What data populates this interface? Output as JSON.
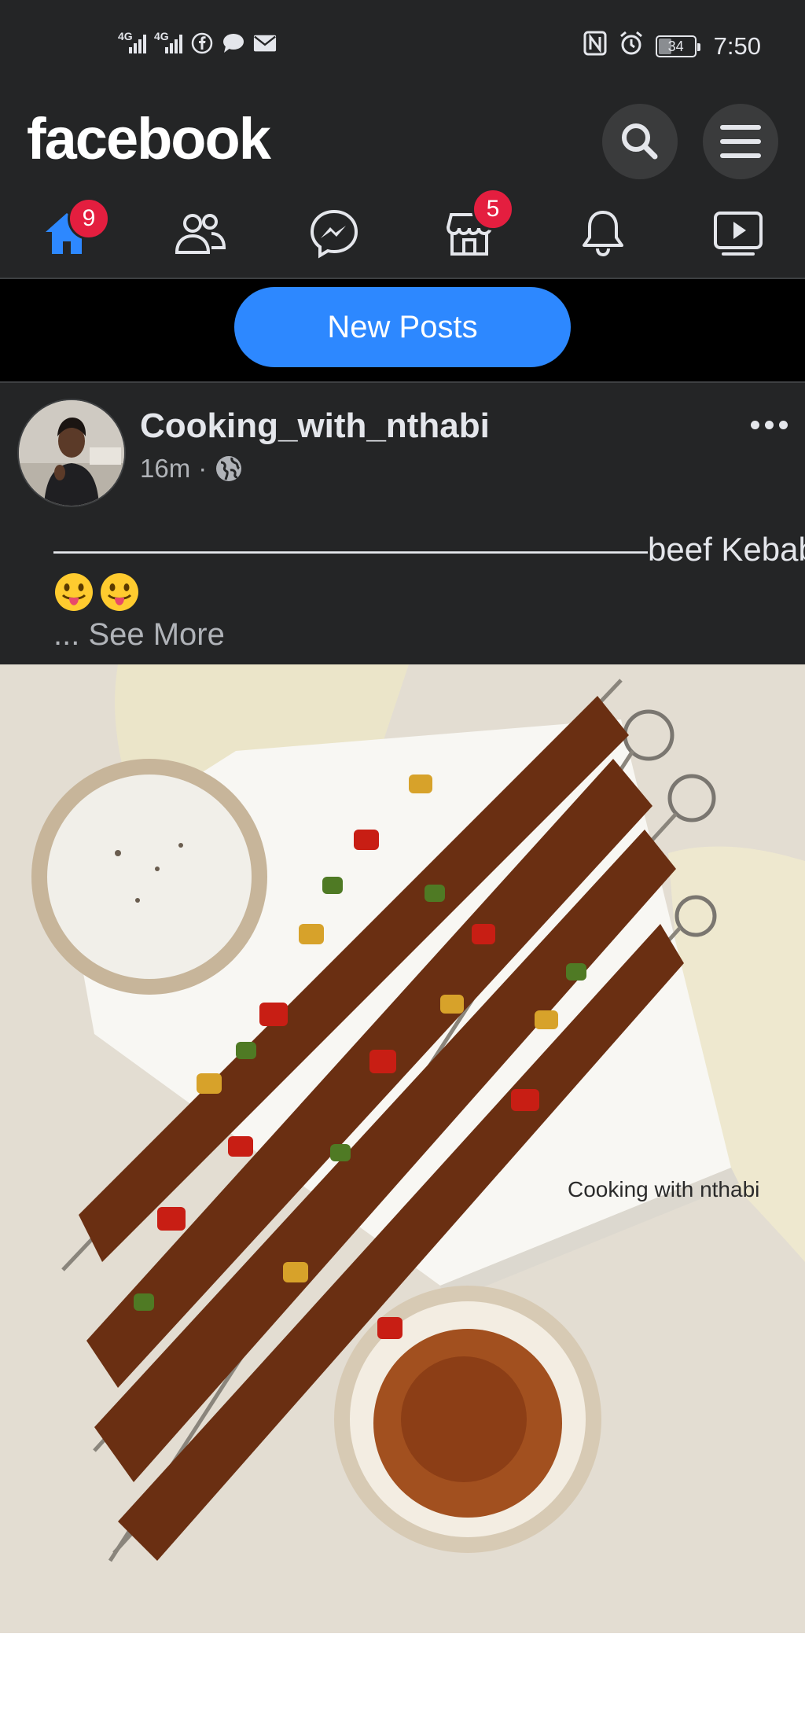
{
  "status_bar": {
    "net1": "4G",
    "net2": "4G",
    "battery": "34",
    "time": "7:50",
    "icons": [
      "signal-icon",
      "facebook-icon",
      "chat-bubble-icon",
      "mail-icon",
      "nfc-icon",
      "alarm-icon",
      "battery-icon"
    ]
  },
  "header": {
    "logo": "facebook",
    "actions": [
      "search-icon",
      "menu-icon"
    ]
  },
  "tabs": [
    {
      "name": "home",
      "icon": "home-icon",
      "badge": "9",
      "active": true
    },
    {
      "name": "friends",
      "icon": "friends-icon",
      "badge": ""
    },
    {
      "name": "messenger",
      "icon": "messenger-icon",
      "badge": ""
    },
    {
      "name": "marketplace",
      "icon": "marketplace-icon",
      "badge": "5"
    },
    {
      "name": "notifications",
      "icon": "bell-icon",
      "badge": ""
    },
    {
      "name": "watch",
      "icon": "video-icon",
      "badge": ""
    }
  ],
  "new_posts": {
    "label": "New Posts"
  },
  "post": {
    "author": "Cooking_with_nthabi",
    "time": "16m",
    "separator": "·",
    "audience_icon": "globe-icon",
    "text": "——————————————————beef Kebabs",
    "emojis": [
      "😛",
      "😛"
    ],
    "see_more": "... See More",
    "photo": {
      "watermark": "Cooking with nthabi",
      "icon": "food-photo"
    }
  },
  "colors": {
    "bar_bg": "#242526",
    "accent": "#2d88ff",
    "badge": "#e41e3f",
    "active_tab": "#2d88ff"
  }
}
